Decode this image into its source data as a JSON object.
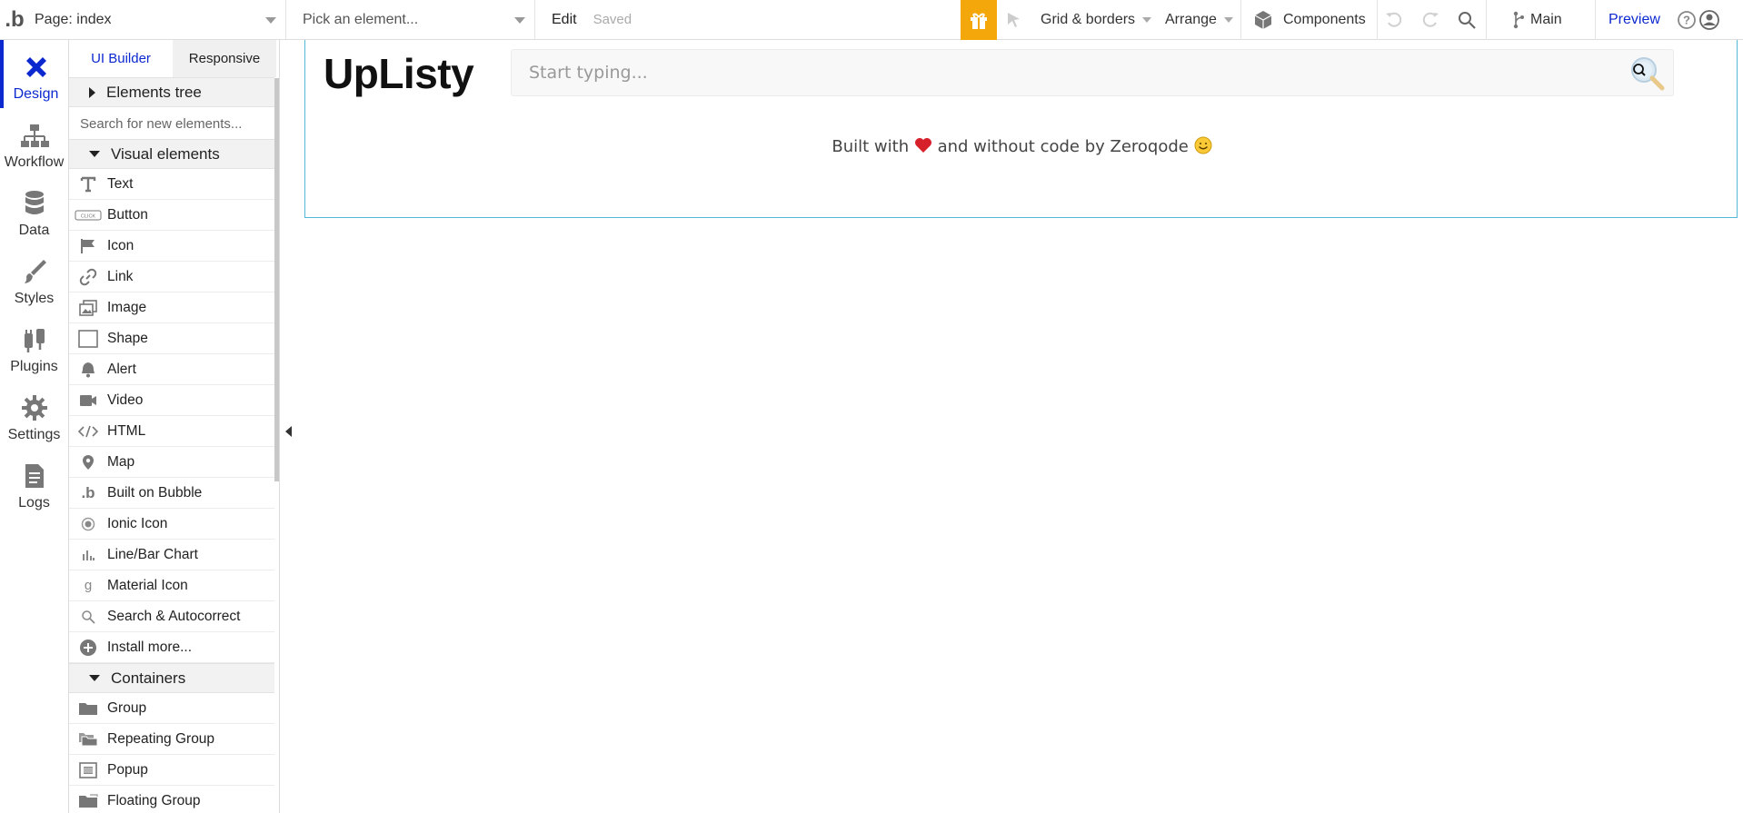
{
  "topbar": {
    "logo": ".b",
    "page_selector": "Page: index",
    "element_picker": "Pick an element...",
    "edit": "Edit",
    "saved": "Saved",
    "grid_borders": "Grid & borders",
    "arrange": "Arrange",
    "components": "Components",
    "branch": "Main",
    "preview": "Preview",
    "accent": "#f4a70b"
  },
  "leftnav": {
    "items": [
      {
        "label": "Design",
        "icon": "design-icon",
        "active": true
      },
      {
        "label": "Workflow",
        "icon": "workflow-icon"
      },
      {
        "label": "Data",
        "icon": "database-icon"
      },
      {
        "label": "Styles",
        "icon": "brush-icon"
      },
      {
        "label": "Plugins",
        "icon": "plug-icon"
      },
      {
        "label": "Settings",
        "icon": "gear-icon"
      },
      {
        "label": "Logs",
        "icon": "document-icon"
      }
    ],
    "active_color": "#0c29d0"
  },
  "palette": {
    "tabs": [
      "UI Builder",
      "Responsive"
    ],
    "elements_tree": "Elements tree",
    "search_placeholder": "Search for new elements...",
    "visual_header": "Visual elements",
    "visual_items": [
      "Text",
      "Button",
      "Icon",
      "Link",
      "Image",
      "Shape",
      "Alert",
      "Video",
      "HTML",
      "Map",
      "Built on Bubble",
      "Ionic Icon",
      "Line/Bar Chart",
      "Material Icon",
      "Search & Autocorrect",
      "Install more..."
    ],
    "containers_header": "Containers",
    "container_items": [
      "Group",
      "Repeating Group",
      "Popup",
      "Floating Group"
    ]
  },
  "canvas": {
    "brand": "UpListy",
    "search_placeholder": "Start typing...",
    "built_pre": "Built with",
    "built_post": "and without code by Zeroqode",
    "frame_color": "#53b8d6"
  }
}
